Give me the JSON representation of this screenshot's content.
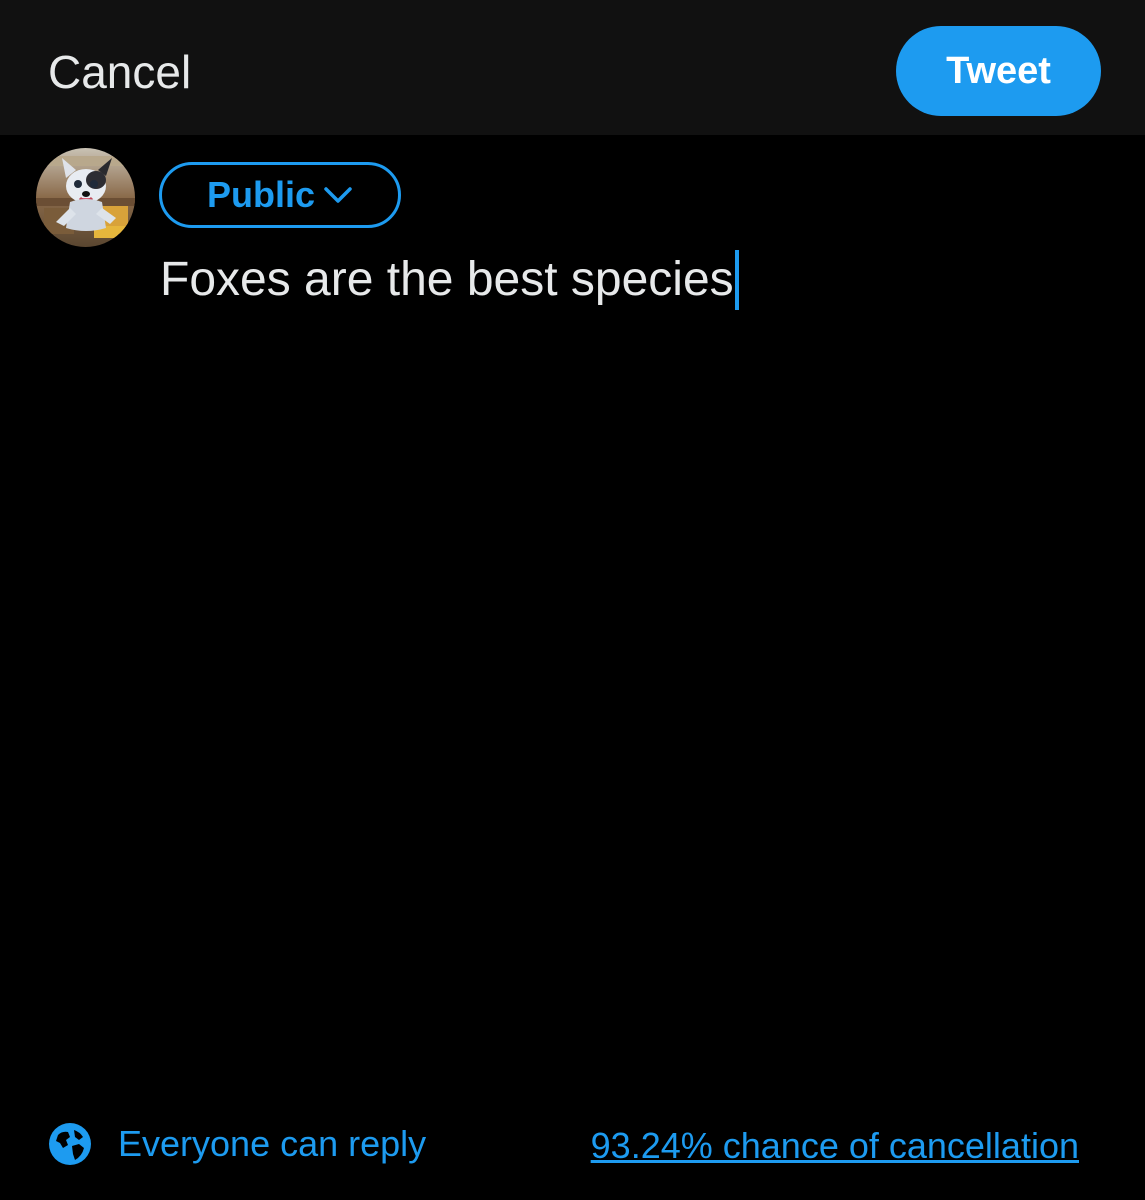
{
  "header": {
    "cancel_label": "Cancel",
    "tweet_label": "Tweet"
  },
  "composer": {
    "audience_label": "Public",
    "text": "Foxes are the best species"
  },
  "footer": {
    "reply_setting_label": "Everyone can reply",
    "cancellation_text": "93.24% chance of cancellation"
  },
  "icons": {
    "audience_dropdown": "chevron-down-icon",
    "reply_setting": "globe-icon"
  },
  "colors": {
    "accent": "#1d9bf0",
    "background": "#000000",
    "header_background": "#111111",
    "text": "#e7e9ea"
  }
}
